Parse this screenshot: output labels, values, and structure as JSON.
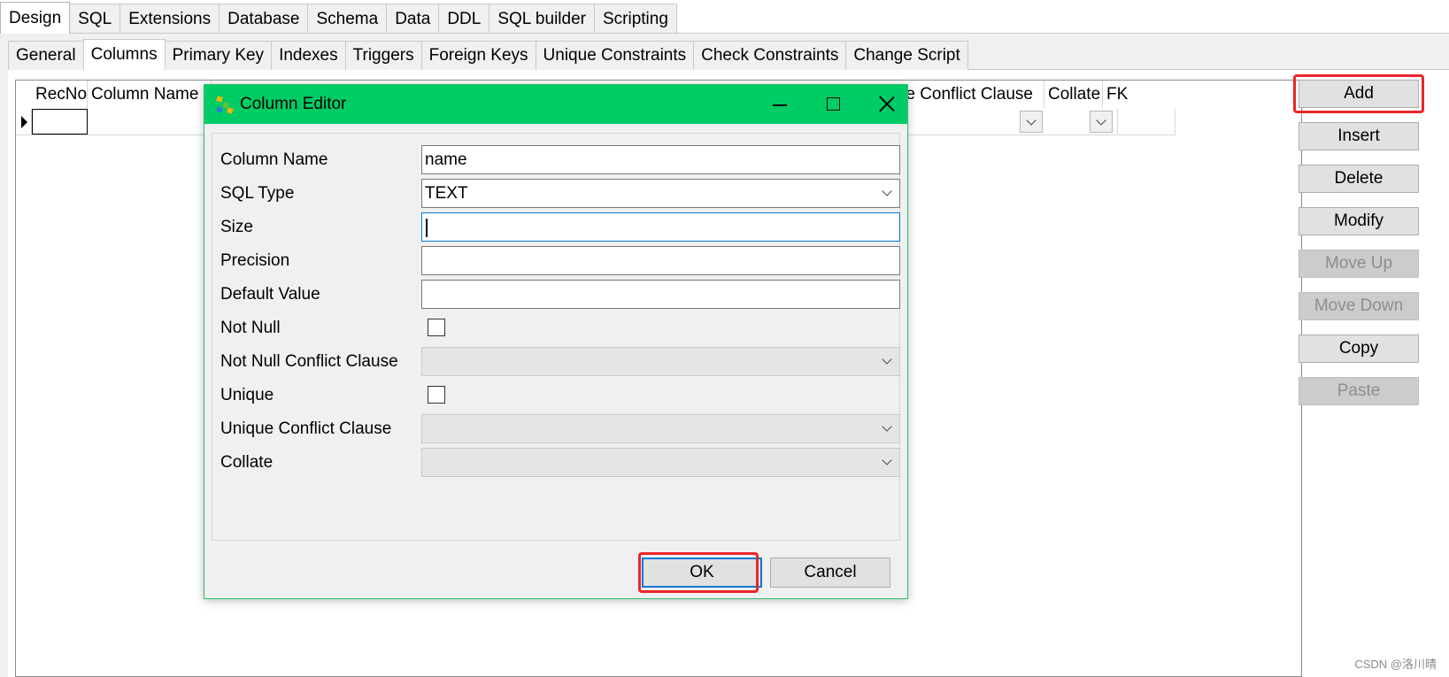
{
  "top_tabs": [
    "Design",
    "SQL",
    "Extensions",
    "Database",
    "Schema",
    "Data",
    "DDL",
    "SQL builder",
    "Scripting"
  ],
  "sub_tabs": [
    "General",
    "Columns",
    "Primary Key",
    "Indexes",
    "Triggers",
    "Foreign Keys",
    "Unique Constraints",
    "Check Constraints",
    "Change Script"
  ],
  "grid": {
    "headers": {
      "recno": "RecNo",
      "column_name": "Column Name",
      "unique_conflict": "ique Conflict Clause",
      "collate": "Collate",
      "fk": "FK"
    }
  },
  "side_buttons": {
    "add": "Add",
    "insert": "Insert",
    "delete": "Delete",
    "modify": "Modify",
    "move_up": "Move Up",
    "move_down": "Move Down",
    "copy": "Copy",
    "paste": "Paste"
  },
  "dialog": {
    "title": "Column Editor",
    "fields": {
      "column_name_label": "Column Name",
      "column_name_value": "name",
      "sql_type_label": "SQL Type",
      "sql_type_value": "TEXT",
      "size_label": "Size",
      "size_value": "",
      "precision_label": "Precision",
      "precision_value": "",
      "default_value_label": "Default Value",
      "default_value_value": "",
      "not_null_label": "Not Null",
      "not_null_checked": false,
      "not_null_conflict_label": "Not Null Conflict Clause",
      "unique_label": "Unique",
      "unique_checked": false,
      "unique_conflict_label": "Unique Conflict Clause",
      "collate_label": "Collate"
    },
    "ok_label": "OK",
    "cancel_label": "Cancel"
  },
  "colors": {
    "titlebar": "#00cc66",
    "highlight": "#e8262b",
    "focus": "#0078d7"
  },
  "watermark": "CSDN @洛川晴"
}
